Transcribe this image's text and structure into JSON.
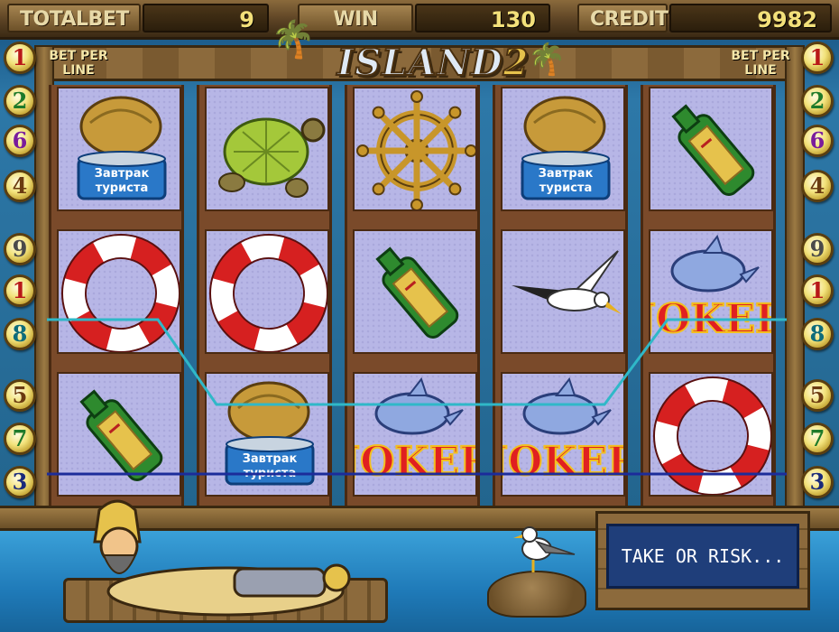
{
  "topbar": {
    "total_bet_label": "TOTALBET",
    "total_bet_value": "9",
    "win_label": "WIN",
    "win_value": "130",
    "credit_label": "CREDIT",
    "credit_value": "9982"
  },
  "title": {
    "text": "ISLAND",
    "number": "2"
  },
  "bet_per_line_left": "BET PER LINE",
  "bet_per_line_right": "BET PER LINE",
  "line_buttons_left": [
    "1",
    "2",
    "6",
    "4",
    "9",
    "1",
    "8",
    "5",
    "7",
    "3"
  ],
  "line_buttons_right": [
    "1",
    "2",
    "6",
    "4",
    "9",
    "1",
    "8",
    "5",
    "7",
    "3"
  ],
  "line_button_colors": [
    "red",
    "green",
    "purple",
    "brown",
    "gray",
    "red",
    "teal",
    "brown",
    "green",
    "navy"
  ],
  "reels": [
    [
      "canned-food",
      "lifebuoy",
      "bottle"
    ],
    [
      "turtle",
      "lifebuoy",
      "canned-food"
    ],
    [
      "ship-wheel",
      "bottle",
      "joker"
    ],
    [
      "canned-food",
      "seagull",
      "joker"
    ],
    [
      "bottle",
      "joker",
      "lifebuoy"
    ]
  ],
  "can_label_line1": "Завтрак",
  "can_label_line2": "туриста",
  "joker_text": "JOKER",
  "message": "TAKE OR RISK...",
  "colors": {
    "payline_cyan": "#2fb8c8",
    "payline_navy": "#1c2c9a",
    "cell_bg": "#b7b6e6",
    "message_bg": "#1f3e7a"
  }
}
